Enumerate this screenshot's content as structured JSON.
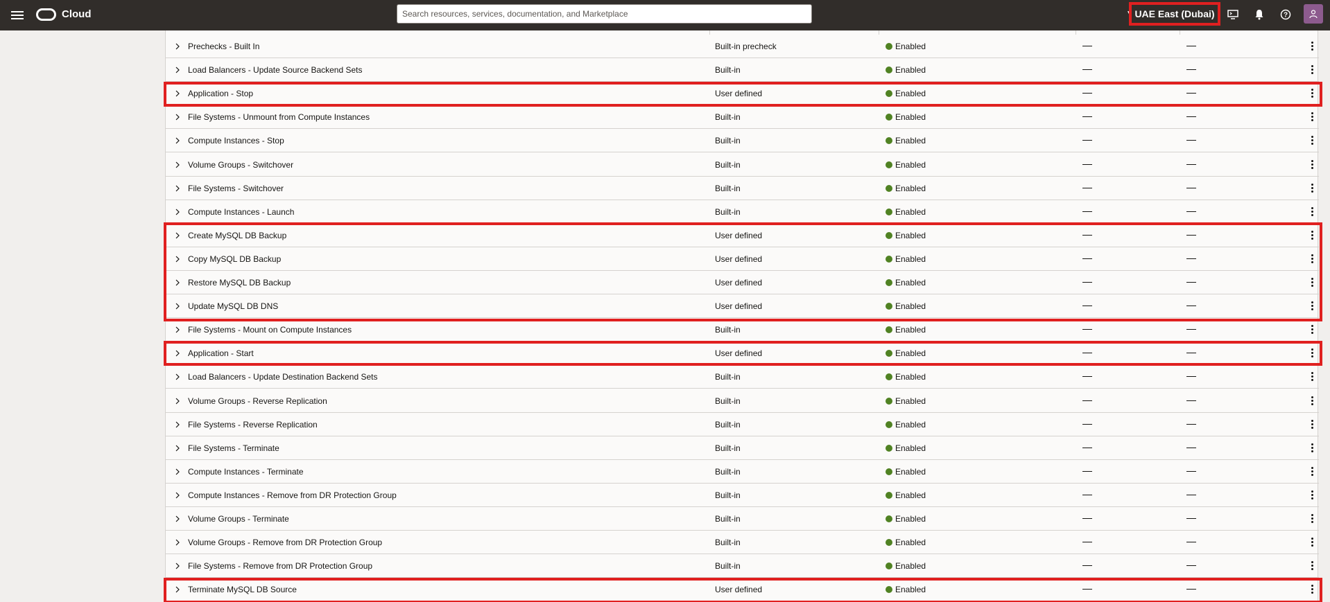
{
  "topbar": {
    "brand": "Cloud",
    "search_placeholder": "Search resources, services, documentation, and Marketplace",
    "region": "UAE East (Dubai)"
  },
  "status_color": "#508223",
  "highlight_color": "#e02020",
  "rows": [
    {
      "name": "Prechecks - Built In",
      "type": "Built-in precheck",
      "status": "Enabled"
    },
    {
      "name": "Load Balancers - Update Source Backend Sets",
      "type": "Built-in",
      "status": "Enabled"
    },
    {
      "name": "Application - Stop",
      "type": "User defined",
      "status": "Enabled"
    },
    {
      "name": "File Systems - Unmount from Compute Instances",
      "type": "Built-in",
      "status": "Enabled"
    },
    {
      "name": "Compute Instances - Stop",
      "type": "Built-in",
      "status": "Enabled"
    },
    {
      "name": "Volume Groups - Switchover",
      "type": "Built-in",
      "status": "Enabled"
    },
    {
      "name": "File Systems - Switchover",
      "type": "Built-in",
      "status": "Enabled"
    },
    {
      "name": "Compute Instances - Launch",
      "type": "Built-in",
      "status": "Enabled"
    },
    {
      "name": "Create MySQL DB Backup",
      "type": "User defined",
      "status": "Enabled"
    },
    {
      "name": "Copy MySQL DB Backup",
      "type": "User defined",
      "status": "Enabled"
    },
    {
      "name": "Restore MySQL DB Backup",
      "type": "User defined",
      "status": "Enabled"
    },
    {
      "name": "Update MySQL DB DNS",
      "type": "User defined",
      "status": "Enabled"
    },
    {
      "name": "File Systems - Mount on Compute Instances",
      "type": "Built-in",
      "status": "Enabled"
    },
    {
      "name": "Application - Start",
      "type": "User defined",
      "status": "Enabled"
    },
    {
      "name": "Load Balancers - Update Destination Backend Sets",
      "type": "Built-in",
      "status": "Enabled"
    },
    {
      "name": "Volume Groups - Reverse Replication",
      "type": "Built-in",
      "status": "Enabled"
    },
    {
      "name": "File Systems - Reverse Replication",
      "type": "Built-in",
      "status": "Enabled"
    },
    {
      "name": "File Systems - Terminate",
      "type": "Built-in",
      "status": "Enabled"
    },
    {
      "name": "Compute Instances - Terminate",
      "type": "Built-in",
      "status": "Enabled"
    },
    {
      "name": "Compute Instances - Remove from DR Protection Group",
      "type": "Built-in",
      "status": "Enabled"
    },
    {
      "name": "Volume Groups - Terminate",
      "type": "Built-in",
      "status": "Enabled"
    },
    {
      "name": "Volume Groups - Remove from DR Protection Group",
      "type": "Built-in",
      "status": "Enabled"
    },
    {
      "name": "File Systems - Remove from DR Protection Group",
      "type": "Built-in",
      "status": "Enabled"
    },
    {
      "name": "Terminate MySQL DB Source",
      "type": "User defined",
      "status": "Enabled"
    }
  ]
}
